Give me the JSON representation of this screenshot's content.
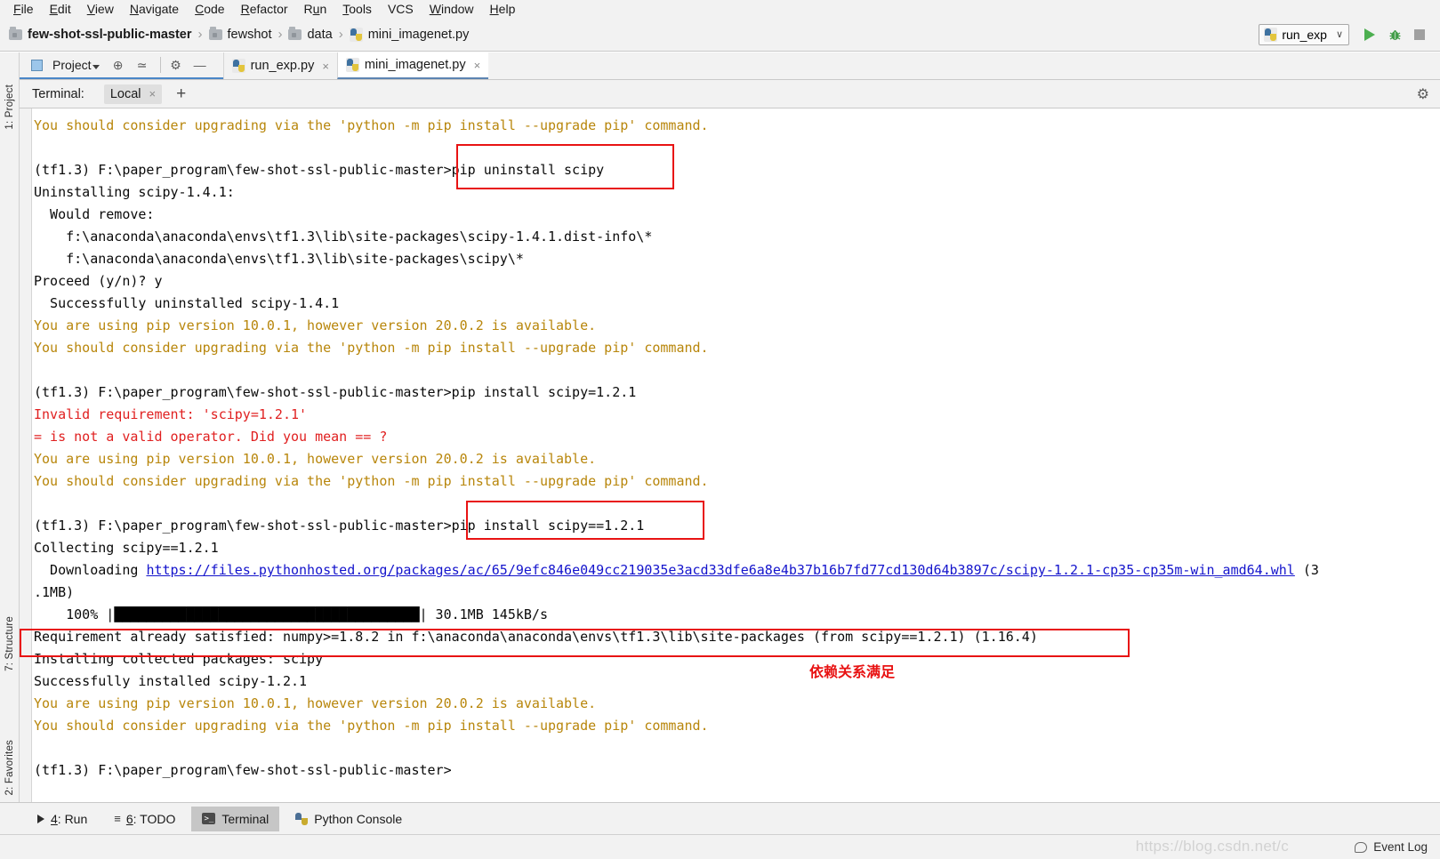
{
  "menu": {
    "items": [
      {
        "pre": "",
        "mn": "F",
        "post": "ile"
      },
      {
        "pre": "",
        "mn": "E",
        "post": "dit"
      },
      {
        "pre": "",
        "mn": "V",
        "post": "iew"
      },
      {
        "pre": "",
        "mn": "N",
        "post": "avigate"
      },
      {
        "pre": "",
        "mn": "C",
        "post": "ode"
      },
      {
        "pre": "",
        "mn": "R",
        "post": "efactor"
      },
      {
        "pre": "R",
        "mn": "u",
        "post": "n"
      },
      {
        "pre": "",
        "mn": "T",
        "post": "ools"
      },
      {
        "pre": "VCS",
        "mn": "",
        "post": ""
      },
      {
        "pre": "",
        "mn": "W",
        "post": "indow"
      },
      {
        "pre": "",
        "mn": "H",
        "post": "elp"
      }
    ]
  },
  "breadcrumb": {
    "items": [
      {
        "label": "few-shot-ssl-public-master",
        "icon": "folder-icon",
        "bold": true
      },
      {
        "label": "fewshot",
        "icon": "folder-icon",
        "bold": false
      },
      {
        "label": "data",
        "icon": "folder-icon",
        "bold": false
      },
      {
        "label": "mini_imagenet.py",
        "icon": "python-file-icon",
        "bold": false
      }
    ],
    "separator": "›"
  },
  "toolbar": {
    "run_config": "run_exp",
    "run_config_chevron": "∨",
    "run_button": "run-button",
    "debug_button": "debug-button",
    "stop_button": "stop-button",
    "bug_glyph": "⚙"
  },
  "left_strips": [
    {
      "label": "1: Project",
      "name": "project-strip"
    },
    {
      "label": "7: Structure",
      "name": "structure-strip"
    },
    {
      "label": "2: Favorites",
      "name": "favorites-strip"
    }
  ],
  "tool_row": {
    "project_label": "Project",
    "icons": [
      "locate-icon",
      "collapse-all-icon",
      "settings-gear-icon",
      "hide-icon"
    ],
    "settings_glyph": "⚙",
    "hide_glyph": "—",
    "locate_glyph": "⊕",
    "collapse_glyph": "≃"
  },
  "editor_tabs": [
    {
      "label": "run_exp.py",
      "active": false,
      "close": "×"
    },
    {
      "label": "mini_imagenet.py",
      "active": true,
      "close": "×"
    }
  ],
  "terminal_header": {
    "label": "Terminal:",
    "tab": "Local",
    "tab_close": "×",
    "add": "+",
    "gear": "⚙"
  },
  "terminal": {
    "lines": [
      {
        "t": "You should consider upgrading via the 'python -m pip install --upgrade pip' command.",
        "c": "warn"
      },
      {
        "t": "",
        "c": "plain"
      },
      {
        "t": "(tf1.3) F:\\paper_program\\few-shot-ssl-public-master>pip uninstall scipy",
        "c": "plain"
      },
      {
        "t": "Uninstalling scipy-1.4.1:",
        "c": "plain"
      },
      {
        "t": "  Would remove:",
        "c": "plain"
      },
      {
        "t": "    f:\\anaconda\\anaconda\\envs\\tf1.3\\lib\\site-packages\\scipy-1.4.1.dist-info\\*",
        "c": "plain"
      },
      {
        "t": "    f:\\anaconda\\anaconda\\envs\\tf1.3\\lib\\site-packages\\scipy\\*",
        "c": "plain"
      },
      {
        "t": "Proceed (y/n)? y",
        "c": "plain"
      },
      {
        "t": "  Successfully uninstalled scipy-1.4.1",
        "c": "plain"
      },
      {
        "t": "You are using pip version 10.0.1, however version 20.0.2 is available.",
        "c": "warn"
      },
      {
        "t": "You should consider upgrading via the 'python -m pip install --upgrade pip' command.",
        "c": "warn"
      },
      {
        "t": "",
        "c": "plain"
      },
      {
        "t": "(tf1.3) F:\\paper_program\\few-shot-ssl-public-master>pip install scipy=1.2.1",
        "c": "plain"
      },
      {
        "t": "Invalid requirement: 'scipy=1.2.1'",
        "c": "err"
      },
      {
        "t": "= is not a valid operator. Did you mean == ?",
        "c": "err"
      },
      {
        "t": "You are using pip version 10.0.1, however version 20.0.2 is available.",
        "c": "warn"
      },
      {
        "t": "You should consider upgrading via the 'python -m pip install --upgrade pip' command.",
        "c": "warn"
      },
      {
        "t": "",
        "c": "plain"
      },
      {
        "t": "(tf1.3) F:\\paper_program\\few-shot-ssl-public-master>pip install scipy==1.2.1",
        "c": "plain"
      },
      {
        "t": "Collecting scipy==1.2.1",
        "c": "plain"
      }
    ],
    "download_line": {
      "prefix": "  Downloading ",
      "url": "https://files.pythonhosted.org/packages/ac/65/9efc846e049cc219035e3acd33dfe6a8e4b37b16b7fd77cd130d64b3897c/scipy-1.2.1-cp35-cp35m-win_amd64.whl",
      "suffix": " (3"
    },
    "lines_after": [
      {
        "t": ".1MB)",
        "c": "plain"
      }
    ],
    "progress": {
      "percent": "100%",
      "bar_open": "|",
      "bar_close": "|",
      "size": "30.1MB",
      "speed": "145kB/s",
      "fill_blocks": 38
    },
    "lines_tail": [
      {
        "t": "Requirement already satisfied: numpy>=1.8.2 in f:\\anaconda\\anaconda\\envs\\tf1.3\\lib\\site-packages (from scipy==1.2.1) (1.16.4)",
        "c": "plain"
      },
      {
        "t": "Installing collected packages: scipy",
        "c": "plain"
      },
      {
        "t": "Successfully installed scipy-1.2.1",
        "c": "plain"
      },
      {
        "t": "You are using pip version 10.0.1, however version 20.0.2 is available.",
        "c": "warn"
      },
      {
        "t": "You should consider upgrading via the 'python -m pip install --upgrade pip' command.",
        "c": "warn"
      },
      {
        "t": "",
        "c": "plain"
      },
      {
        "t": "(tf1.3) F:\\paper_program\\few-shot-ssl-public-master>",
        "c": "plain"
      }
    ],
    "annotations": {
      "note_cn": "依赖关系满足",
      "highlight_color": "#e81313"
    }
  },
  "bottom_bar": {
    "buttons": [
      {
        "label_pre": "",
        "key": "4",
        "label": ": Run",
        "icon": "run-triangle-icon",
        "active": false
      },
      {
        "label_pre": "",
        "key": "6",
        "label": ": TODO",
        "icon": "todo-list-icon",
        "active": false
      },
      {
        "label_pre": "",
        "key": "",
        "label": "Terminal",
        "icon": "terminal-icon",
        "active": true
      },
      {
        "label_pre": "",
        "key": "",
        "label": "Python Console",
        "icon": "python-console-icon",
        "active": false
      }
    ],
    "terminal_glyph": ">_"
  },
  "status_bar": {
    "watermark": "https://blog.csdn.net/c",
    "event_log": "Event Log"
  }
}
